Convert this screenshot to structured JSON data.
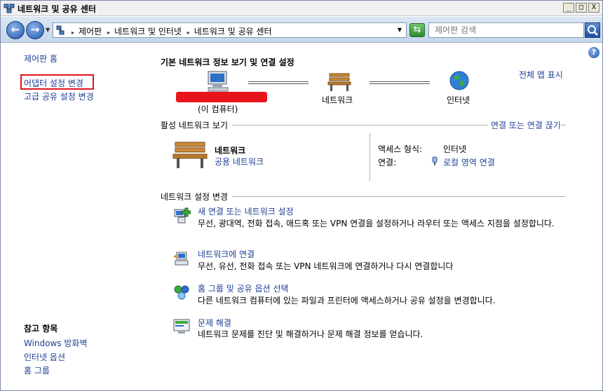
{
  "window": {
    "title": "네트워크 및 공유 센터",
    "buttons": {
      "minimize": "_",
      "maximize": "□",
      "close": "X"
    }
  },
  "addressbar": {
    "back": "←",
    "forward": "→",
    "crumbs": [
      "제어판",
      "네트워크 및 인터넷",
      "네트워크 및 공유 센터"
    ],
    "search_placeholder": "제어판 검색"
  },
  "sidebar": {
    "home": "제어판 홈",
    "links": [
      "어댑터 설정 변경",
      "고급 공유 설정 변경"
    ],
    "see_also_heading": "참고 항목",
    "see_also": [
      "Windows 방화벽",
      "인터넷 옵션",
      "홈 그룹"
    ]
  },
  "main": {
    "title": "기본 네트워크 정보 보기 및 연결 설정",
    "full_map": "전체 맵 표시",
    "map": {
      "computer_label": "(이 컴퓨터)",
      "network_label": "네트워크",
      "internet_label": "인터넷"
    },
    "active_section": {
      "heading": "활성 네트워크 보기",
      "action": "연결 또는 연결 끊기",
      "network_name": "네트워크",
      "network_type": "공용 네트워크",
      "access_type_key": "액세스 형식:",
      "access_type_value": "인터넷",
      "connection_key": "연결:",
      "connection_value": "로컬 영역 연결"
    },
    "settings_section": {
      "heading": "네트워크 설정 변경",
      "tasks": [
        {
          "title": "새 연결 또는 네트워크 설정",
          "desc": "무선, 광대역, 전화 접속, 애드혹 또는 VPN 연결을 설정하거나 라우터 또는 액세스 지점을 설정합니다."
        },
        {
          "title": "네트워크에 연결",
          "desc": "무선, 유선, 전화 접속 또는 VPN 네트워크에 연결하거나 다시 연결합니다"
        },
        {
          "title": "홈 그룹 및 공유 옵션 선택",
          "desc": "다른 네트워크 컴퓨터에 있는 파일과 프린터에 액세스하거나 공유 설정을 변경합니다."
        },
        {
          "title": "문제 해결",
          "desc": "네트워크 문제를 진단 및 해결하거나 문제 해결 정보를 얻습니다."
        }
      ]
    }
  },
  "colors": {
    "link": "#1e3f94",
    "highlight_box": "#e0141e",
    "redaction": "#e8141c"
  }
}
